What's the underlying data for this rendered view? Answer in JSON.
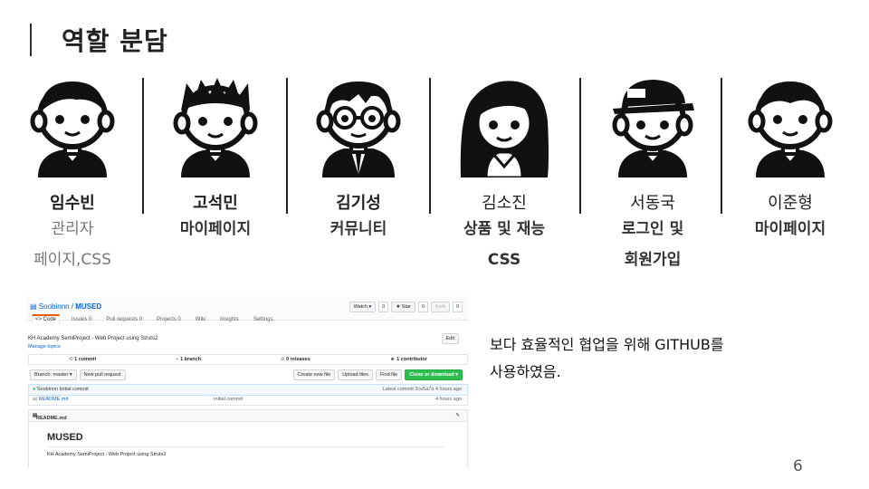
{
  "slide": {
    "title": "역할 분담",
    "page_number": "6"
  },
  "members": [
    {
      "name": "임수빈",
      "role_lines": [
        "관리자",
        "페이지,CSS"
      ],
      "avatar": "boy-avatar-icon"
    },
    {
      "name": "고석민",
      "role_lines": [
        "마이페이지"
      ],
      "avatar": "boy-spiky-hair-avatar-icon"
    },
    {
      "name": "김기성",
      "role_lines": [
        "커뮤니티"
      ],
      "avatar": "boy-glasses-avatar-icon"
    },
    {
      "name": "김소진",
      "role_lines": [
        "상품 및 재능",
        "CSS"
      ],
      "avatar": "girl-avatar-icon"
    },
    {
      "name": "서동국",
      "role_lines": [
        "로그인 및",
        "회원가입"
      ],
      "avatar": "boy-cap-avatar-icon"
    },
    {
      "name": "이준형",
      "role_lines": [
        "마이페이지"
      ],
      "avatar": "boy-avatar-icon"
    }
  ],
  "github": {
    "owner": "Soobinnn",
    "repo": "MUSED",
    "watch_label": "Watch ▾",
    "watch_count": "0",
    "star_label": "★ Star",
    "star_count": "0",
    "fork_label": "Fork",
    "fork_count": "0",
    "tabs": [
      "<> Code",
      "Issues 0",
      "Pull requests 0",
      "Projects 0",
      "Wiki",
      "Insights",
      "Settings"
    ],
    "description": "KH Academy SemiProject - Web Project using Struts2",
    "manage_topics": "Manage topics",
    "edit_label": "Edit",
    "stats": {
      "commits": "1 commit",
      "branches": "1 branch",
      "releases": "0 releases",
      "contributors": "1 contributor"
    },
    "branch_label": "Branch: master ▾",
    "new_pr_label": "New pull request",
    "create_file_label": "Create new file",
    "upload_label": "Upload files",
    "find_label": "Find file",
    "clone_label": "Clone or download ▾",
    "latest_commit_left": "Soobinnn Initial commit",
    "latest_commit_right": "Latest commit 3ce5a7a 4 hours ago",
    "file_name": "README.md",
    "file_commit": "Initial commit",
    "file_time": "4 hours ago",
    "readme_header": "README.md",
    "readme_title": "MUSED",
    "readme_text": "KH Academy SemiProject - Web Project using Struts2"
  },
  "note_lines": [
    "보다 효율적인 협업을 위해 GITHUB를",
    "사용하였음."
  ]
}
